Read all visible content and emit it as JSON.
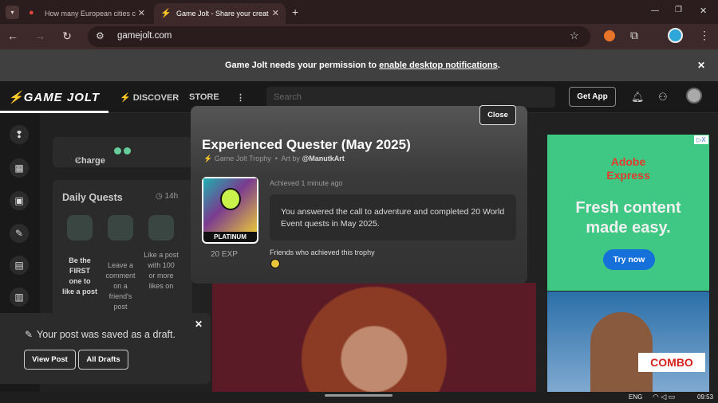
{
  "browser": {
    "tabs": [
      {
        "title": "How many European cities c"
      },
      {
        "title": "Game Jolt - Share your creat"
      }
    ],
    "url": "gamejolt.com",
    "new_tab": "+",
    "minimize": "—",
    "restore": "❐",
    "close": "✕"
  },
  "notification": {
    "prefix": "Game Jolt needs your permission to ",
    "link": "enable desktop notifications",
    "suffix": ".",
    "close": "✕"
  },
  "nav": {
    "logo": "GAME JOLT",
    "discover": "DISCOVER",
    "store": "STORE",
    "more": "⋮",
    "search_placeholder": "Search",
    "get_app": "Get App"
  },
  "sidebar": {
    "charge_label": "Charge",
    "daily_quests_title": "Daily Quests",
    "daily_quests_time": "14h",
    "quests": [
      {
        "text": "Be the FIRST one to like a post"
      },
      {
        "text": "Leave a comment on a friend's post"
      },
      {
        "text": "Like a post with 100 or more likes on"
      }
    ]
  },
  "modal": {
    "close": "Close",
    "title": "Experienced Quester (May 2025)",
    "trophy_type": "Game Jolt Trophy",
    "art_by_prefix": "Art by ",
    "artist": "@ManutkArt",
    "tier": "PLATINUM",
    "exp": "20 EXP",
    "achieved": "Achieved 1 minute ago",
    "description": "You answered the call to adventure and completed 20 World Event quests in May 2025.",
    "friends_label": "Friends who achieved this trophy"
  },
  "ad": {
    "brand_line1": "Adobe",
    "brand_line2": "Express",
    "headline_line1": "Fresh content",
    "headline_line2": "made easy.",
    "cta": "Try now",
    "badge": "COMBO",
    "adchoices": "▷X"
  },
  "toast": {
    "message": "Your post was saved as a draft.",
    "view_post": "View Post",
    "all_drafts": "All Drafts",
    "close": "✕"
  },
  "taskbar": {
    "lang": "ENG",
    "time": "09:53"
  }
}
